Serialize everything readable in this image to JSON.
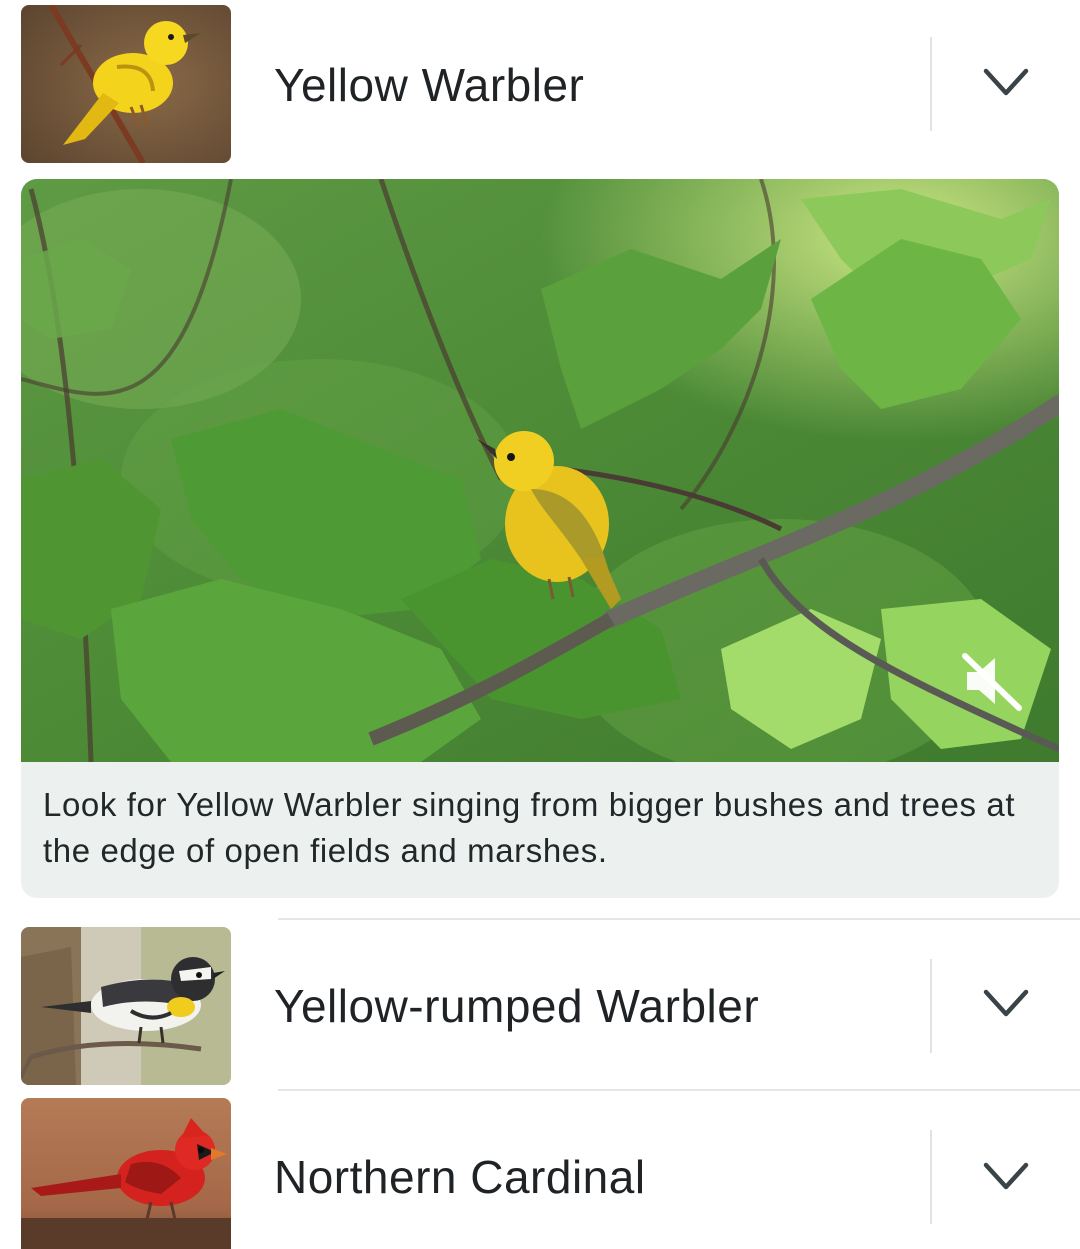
{
  "species": [
    {
      "name": "Yellow Warbler",
      "thumbnail_icon": "yellow-warbler-photo",
      "expand_icon": "chevron-down-icon",
      "expanded": true
    },
    {
      "name": "Yellow-rumped Warbler",
      "thumbnail_icon": "yellow-rumped-warbler-photo",
      "expand_icon": "chevron-down-icon",
      "expanded": false
    },
    {
      "name": "Northern Cardinal",
      "thumbnail_icon": "northern-cardinal-photo",
      "expand_icon": "chevron-down-icon",
      "expanded": false
    }
  ],
  "media": {
    "caption": "Look for Yellow Warbler singing from bigger bushes and trees at the edge of open fields and marshes.",
    "mute_icon": "volume-off-icon",
    "muted": true
  },
  "colors": {
    "text": "#1f2326",
    "caption_bg": "#ecf1ef",
    "divider": "#e3e7e7",
    "chevron": "#3a4347"
  }
}
